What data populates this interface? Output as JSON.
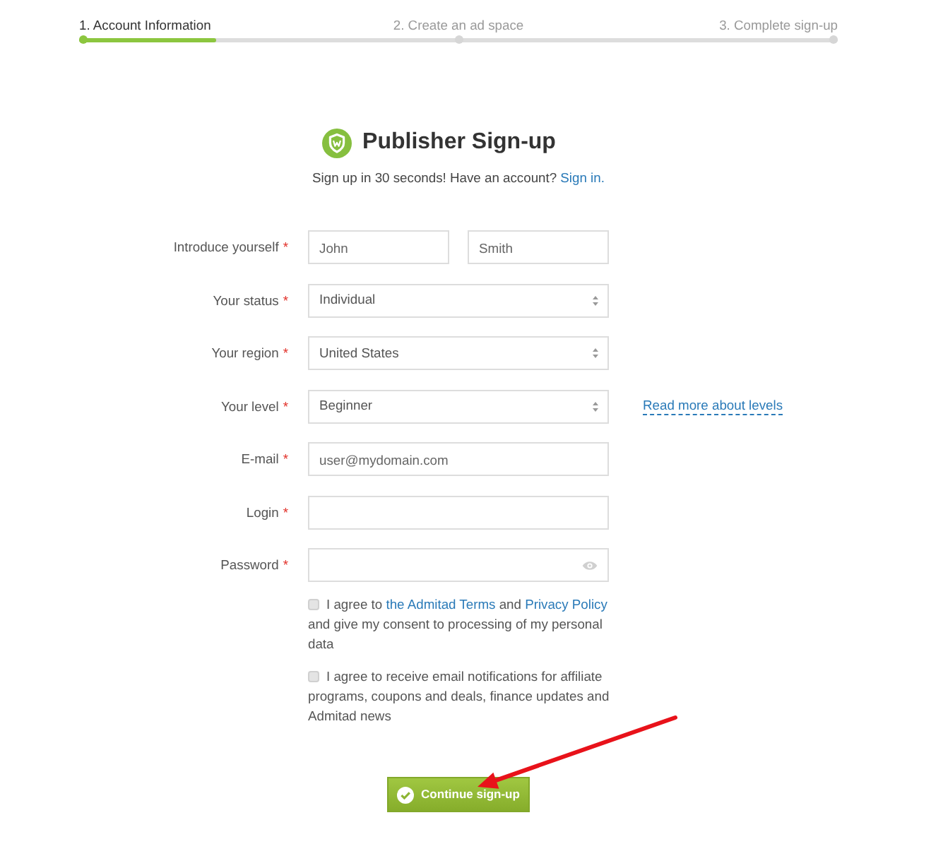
{
  "progress": {
    "steps": [
      {
        "label": "1. Account Information",
        "selected": true
      },
      {
        "label": "2. Create an ad space",
        "selected": false
      },
      {
        "label": "3. Complete sign-up",
        "selected": false
      }
    ],
    "level": 0.18
  },
  "header": {
    "title": "Publisher Sign-up",
    "subtitle": "Sign up in 30 seconds! Have an account?",
    "signin_link": "Sign in."
  },
  "form": {
    "fields": [
      {
        "kind": "name_pair",
        "label": "Introduce yourself",
        "required_mark": "*",
        "inputs": [
          {
            "placeholder": "John"
          },
          {
            "placeholder": "Smith"
          }
        ]
      },
      {
        "kind": "select",
        "label": "Your status",
        "required_mark": "*",
        "value": "Individual"
      },
      {
        "kind": "select",
        "label": "Your region",
        "required_mark": "*",
        "value": "United States"
      },
      {
        "kind": "select",
        "label": "Your level",
        "required_mark": "*",
        "value": "Beginner",
        "link": "Read more about levels"
      },
      {
        "kind": "text",
        "label": "E-mail",
        "required_mark": "*",
        "placeholder": "user@mydomain.com"
      },
      {
        "kind": "text",
        "label": "Login",
        "required_mark": "*"
      },
      {
        "kind": "password",
        "label": "Password",
        "required_mark": "*"
      }
    ]
  },
  "agreements": [
    {
      "checked": false,
      "parts": [
        {
          "kind": "text",
          "text": "I agree to"
        },
        {
          "kind": "link",
          "text": "the Admitad Terms"
        },
        {
          "kind": "text",
          "text": "and"
        },
        {
          "kind": "link",
          "text": "Privacy Policy"
        },
        {
          "kind": "text",
          "text": "and give my consent to processing of my personal data"
        }
      ]
    },
    {
      "checked": false,
      "parts": [
        {
          "kind": "text",
          "text": "I agree to receive email notifications for affiliate programs, coupons and deals, finance updates and Admitad news"
        }
      ]
    }
  ],
  "submit": {
    "label": "Continue sign-up"
  }
}
